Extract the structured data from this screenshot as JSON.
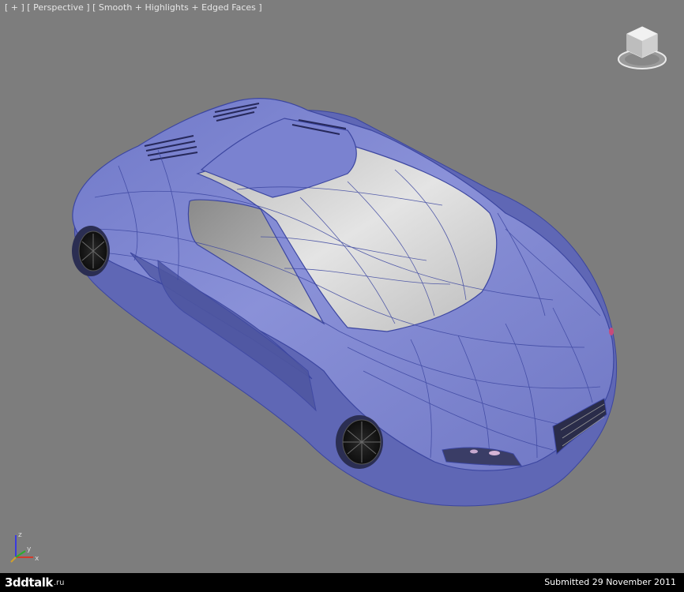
{
  "viewport": {
    "label": "[ + ] [ Perspective ] [ Smooth + Highlights + Edged Faces ]",
    "background": "#7d7d7d",
    "model_color": "#7f86d2",
    "glass_color": "#d3d3d3",
    "wire_color": "#3c46a0"
  },
  "viewcube": {
    "icon": "viewcube-icon"
  },
  "axis": {
    "x_label": "x",
    "y_label": "y",
    "z_label": "z"
  },
  "footer": {
    "logo_text": "3ddtalk",
    "logo_tld": ".ru",
    "submitted": "Submitted 29 November 2011"
  }
}
